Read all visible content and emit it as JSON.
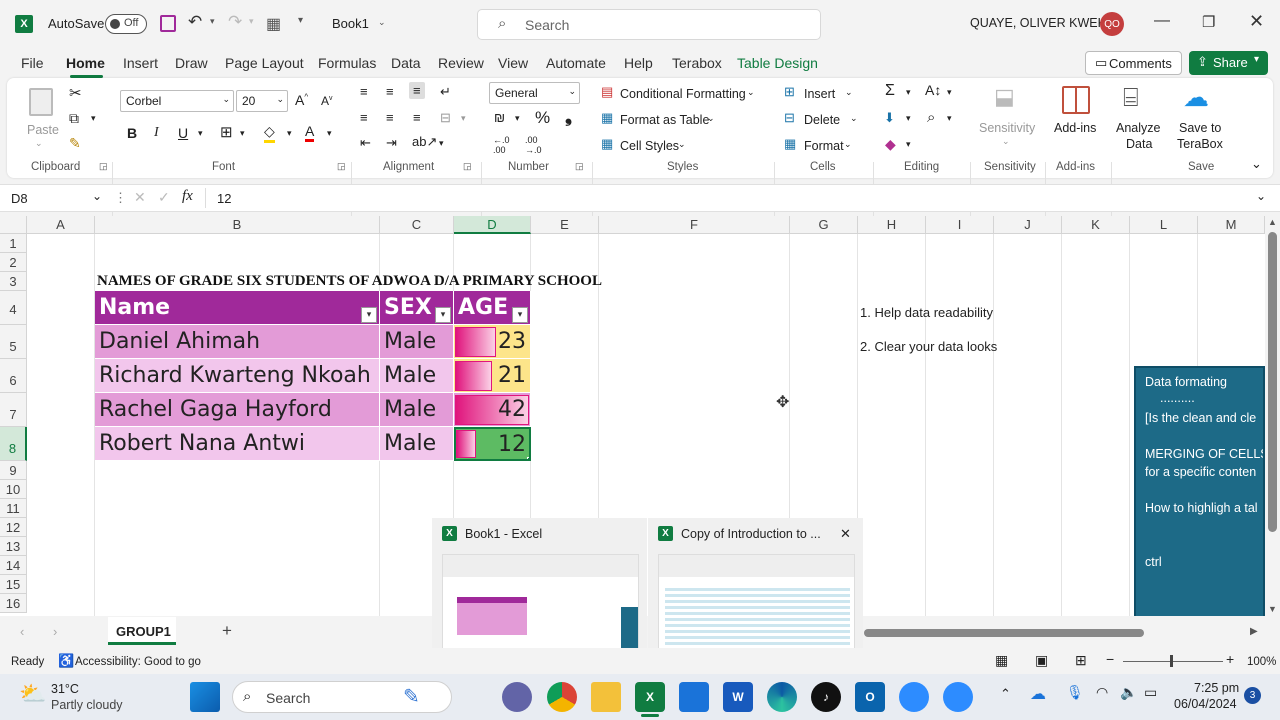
{
  "titlebar": {
    "autosave": "AutoSave",
    "autosave_state": "Off",
    "book": "Book1",
    "search_placeholder": "Search",
    "user": "QUAYE, OLIVER KWEKU",
    "initials": "QO"
  },
  "tabs": [
    "File",
    "Home",
    "Insert",
    "Draw",
    "Page Layout",
    "Formulas",
    "Data",
    "Review",
    "View",
    "Automate",
    "Help",
    "Terabox",
    "Table Design"
  ],
  "top_buttons": {
    "comments": "Comments",
    "share": "Share"
  },
  "ribbon": {
    "clipboard": {
      "paste": "Paste",
      "group": "Clipboard"
    },
    "font": {
      "name": "Corbel",
      "size": "20",
      "group": "Font"
    },
    "alignment": {
      "group": "Alignment"
    },
    "number": {
      "format": "General",
      "group": "Number"
    },
    "styles": {
      "cond": "Conditional Formatting",
      "table": "Format as Table",
      "cell": "Cell Styles",
      "group": "Styles"
    },
    "cells": {
      "insert": "Insert",
      "delete": "Delete",
      "format": "Format",
      "group": "Cells"
    },
    "editing": {
      "group": "Editing"
    },
    "sensitivity": {
      "label": "Sensitivity",
      "group": "Sensitivity"
    },
    "addins": {
      "label": "Add-ins",
      "group": "Add-ins"
    },
    "analyze": {
      "line1": "Analyze",
      "line2": "Data"
    },
    "save": {
      "line1": "Save to",
      "line2": "TeraBox",
      "group": "Save"
    }
  },
  "formula": {
    "cellref": "D8",
    "value": "12"
  },
  "columns": [
    "A",
    "B",
    "C",
    "D",
    "E",
    "F",
    "G",
    "H",
    "I",
    "J",
    "K",
    "L",
    "M"
  ],
  "rows": [
    "1",
    "2",
    "3",
    "4",
    "5",
    "6",
    "7",
    "8",
    "9",
    "10",
    "11",
    "12",
    "13",
    "14",
    "15",
    "16"
  ],
  "sheet": {
    "title": "NAMES OF GRADE SIX STUDENTS OF ADWOA D/A PRIMARY SCHOOL",
    "headers": [
      "Name",
      "SEX",
      "AGE"
    ],
    "records": [
      {
        "name": "Daniel Ahimah",
        "sex": "Male",
        "age": "23",
        "age_fill": 0.55
      },
      {
        "name": "Richard Kwarteng Nkoah",
        "sex": "Male",
        "age": "21",
        "age_fill": 0.5
      },
      {
        "name": "Rachel Gaga Hayford",
        "sex": "Male",
        "age": "42",
        "age_fill": 1.0
      },
      {
        "name": "Robert Nana Antwi",
        "sex": "Male",
        "age": "12",
        "age_fill": 0.28
      }
    ],
    "notes": [
      "1. Help data readability",
      "2. Clear your data looks"
    ],
    "textbox": [
      "Data formating",
      "..........",
      "[Is the clean and cle",
      "MERGING OF CELLS",
      "for a specific conten",
      "How to highligh a tal",
      "ctrl"
    ]
  },
  "thumbnails": [
    {
      "title": "Book1 - Excel"
    },
    {
      "title": "Copy of Introduction to ..."
    }
  ],
  "sheet_tab": "GROUP1",
  "status": {
    "ready": "Ready",
    "accessibility": "Accessibility: Good to go",
    "zoom": "100%"
  },
  "taskbar": {
    "temp": "31°C",
    "weather": "Partly cloudy",
    "search": "Search",
    "time": "7:25 pm",
    "date": "06/04/2024",
    "badge": "3"
  },
  "colors": {
    "header_purple": "#a0299a",
    "row_pink": "#e39bd7",
    "row_light": "#f2c6ec",
    "excel_green": "#107c41",
    "note_panel": "#1d6a87",
    "age_green": "#5dbb63",
    "age_yellow": "#fde58a"
  }
}
